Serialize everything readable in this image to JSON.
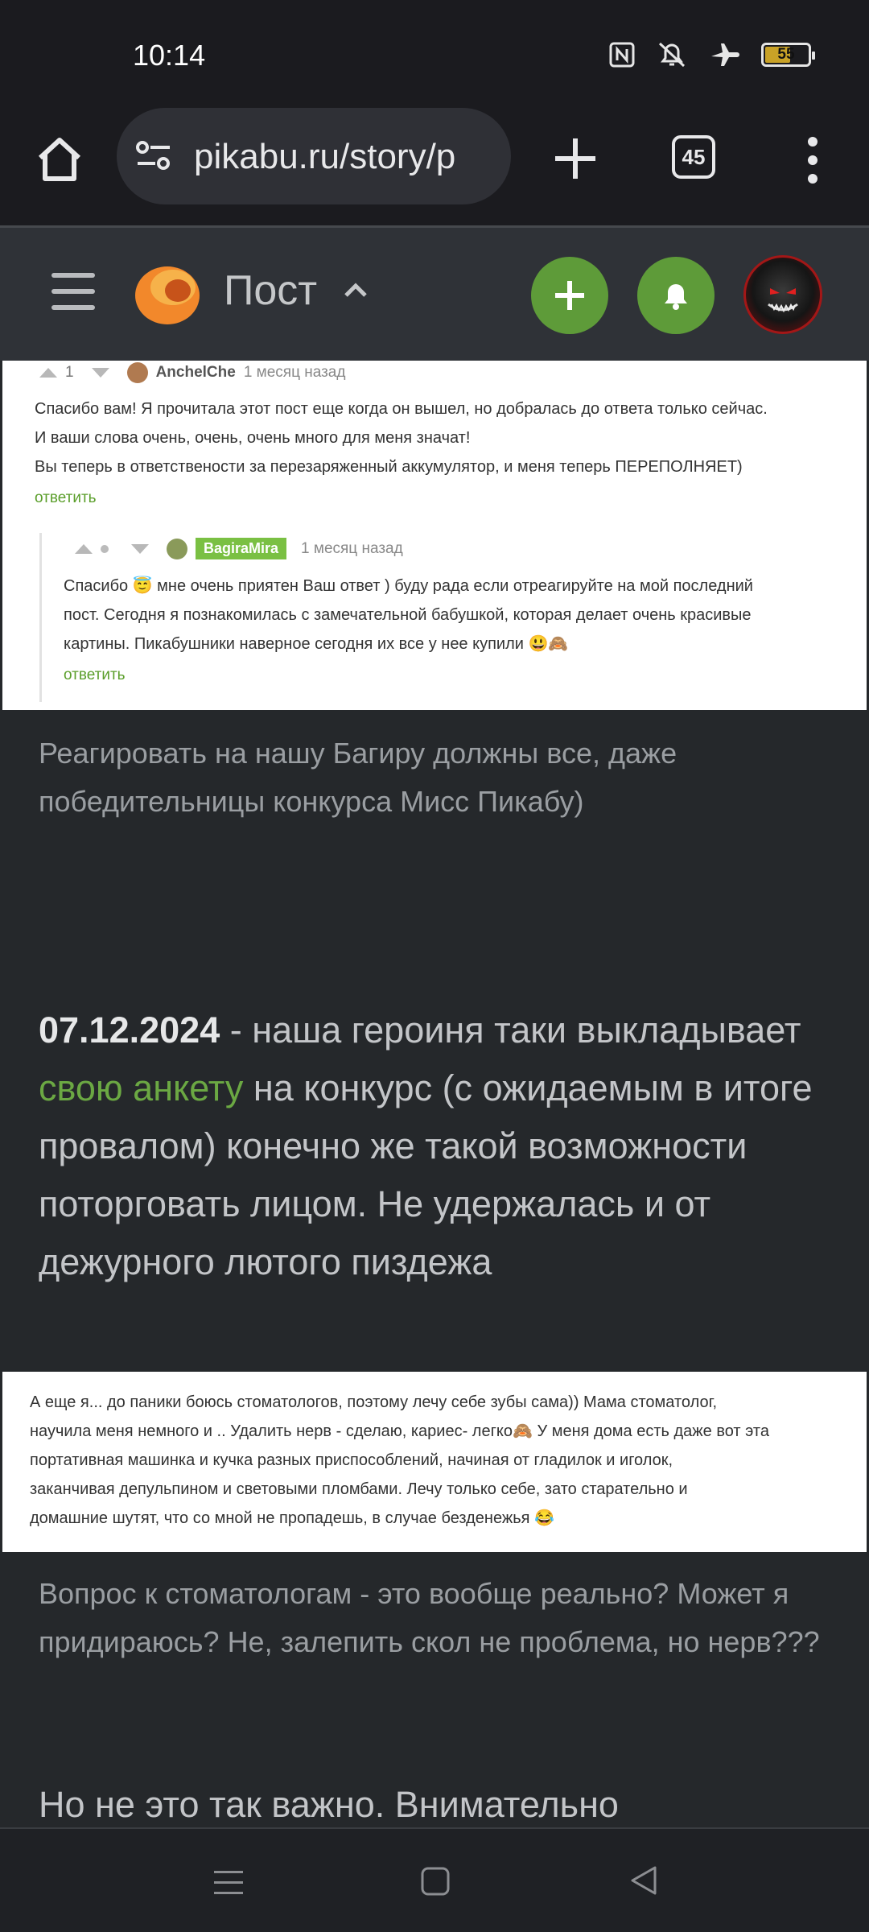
{
  "status": {
    "time": "10:14",
    "battery": "55"
  },
  "browser": {
    "url": "pikabu.ru/story/p",
    "tabs_count": "45"
  },
  "header": {
    "title": "Пост"
  },
  "comment1": {
    "votes": "1",
    "author": "AnchelChe",
    "time": "1 месяц назад",
    "line1": "Спасибо вам! Я прочитала этот пост еще когда он вышел, но добралась до ответа только сейчас.",
    "line2": "И ваши слова очень, очень, очень много для меня значат!",
    "line3": "Вы теперь в ответствености за перезаряженный аккумулятор, и меня теперь ПЕРЕПОЛНЯЕТ)",
    "reply": "ответить"
  },
  "comment2": {
    "author": "BagiraMira",
    "time": "1 месяц назад",
    "line1": "Спасибо 😇 мне очень приятен Ваш ответ ) буду рада если отреагируйте на мой последний",
    "line2": "пост. Сегодня я познакомилась с замечательной бабушкой, которая делает очень красивые",
    "line3": "картины. Пикабушники наверное сегодня их все у нее купили 😃🙈",
    "reply": "ответить"
  },
  "caption1": "Реагировать на нашу Багиру должны все, даже победительницы конкурса Мисс Пикабу)",
  "paragraph": {
    "date": "07.12.2024",
    "text_before": " - наша героиня таки выкладывает ",
    "link": "свою анкету",
    "text_after": " на конкурс (с ожидаемым в итоге провалом) конечно же такой возможности поторговать лицом. Не удержалась и от дежурного лютого пиздежа"
  },
  "quote": {
    "line1": "А еще я... до паники боюсь стоматологов, поэтому лечу себе зубы сама)) Мама стоматолог,",
    "line2": "научила меня немного и .. Удалить нерв - сделаю, кариес- легко🙈 У меня дома есть даже вот эта",
    "line3": "портативная машинка и кучка разных приспособлений, начиная от гладилок и иголок,",
    "line4": "заканчивая депульпином и световыми пломбами. Лечу только себе, зато старательно и",
    "line5": "домашние шутят, что со мной не пропадешь, в случае безденежья 😂"
  },
  "caption2": "Вопрос к стоматологам - это вообще реально? Может я придираюсь? Не, залепить скол не проблема, но нерв???",
  "paragraph2": "Но не это так важно. Внимательно"
}
